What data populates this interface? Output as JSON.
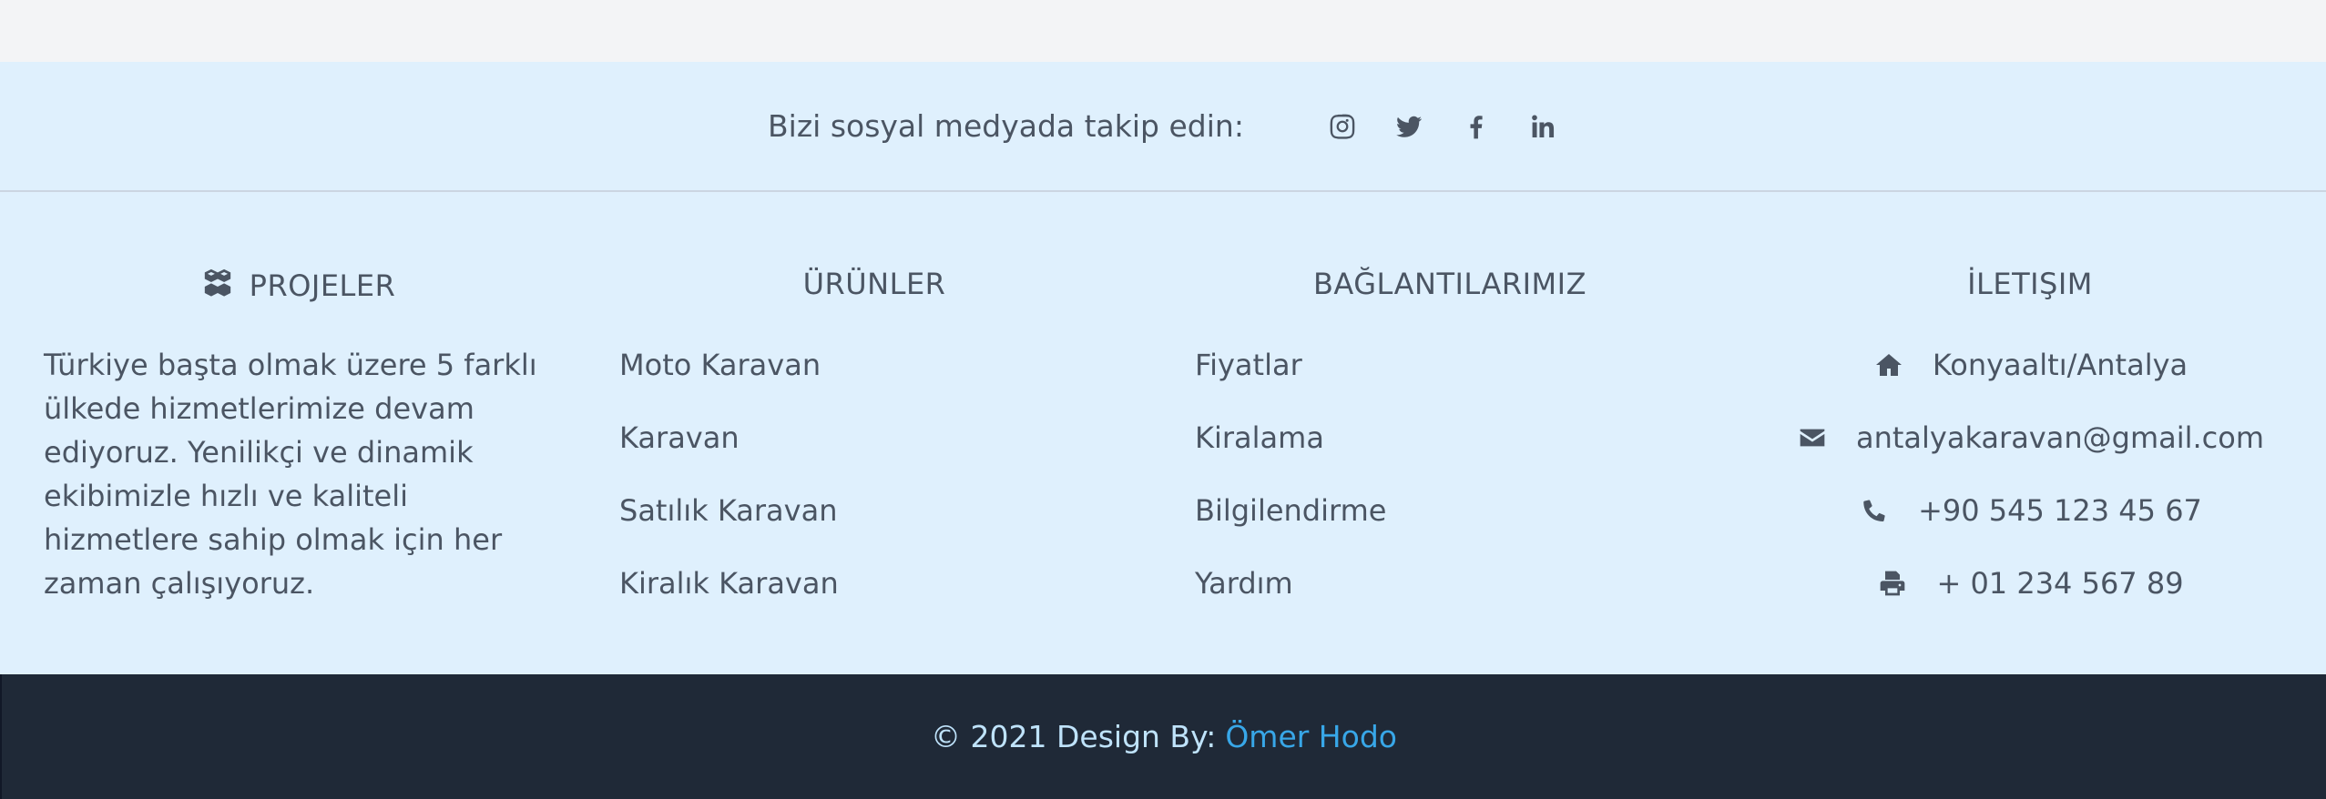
{
  "social": {
    "follow_text": "Bizi sosyal medyada takip edin:",
    "icons": [
      "instagram-icon",
      "twitter-icon",
      "facebook-icon",
      "linkedin-icon"
    ]
  },
  "projects": {
    "heading": "PROJELER",
    "icon": "cubes-icon",
    "description": "Türkiye başta olmak üzere 5 farklı ülkede hizmetlerimize devam ediyoruz. Yenilikçi ve dinamik ekibimizle hızlı ve kaliteli hizmetlere sahip olmak için her zaman çalışıyoruz."
  },
  "products": {
    "heading": "ÜRÜNLER",
    "items": [
      "Moto Karavan",
      "Karavan",
      "Satılık Karavan",
      "Kiralık Karavan"
    ]
  },
  "links": {
    "heading": "BAĞLANTILARIMIZ",
    "items": [
      "Fiyatlar",
      "Kiralama",
      "Bilgilendirme",
      "Yardım"
    ]
  },
  "contact": {
    "heading": "İLETIŞIM",
    "address": "Konyaaltı/Antalya",
    "email": "antalyakaravan@gmail.com",
    "phone": "+90 545 123 45 67",
    "fax": "+ 01 234 567 89"
  },
  "copyright": {
    "prefix": "© 2021 Design By:",
    "author": "Ömer Hodo"
  },
  "colors": {
    "footer_bg": "#dff0fd",
    "bottom_bg": "#1f2937",
    "text": "#4b5563",
    "author_link": "#38a7e8"
  }
}
